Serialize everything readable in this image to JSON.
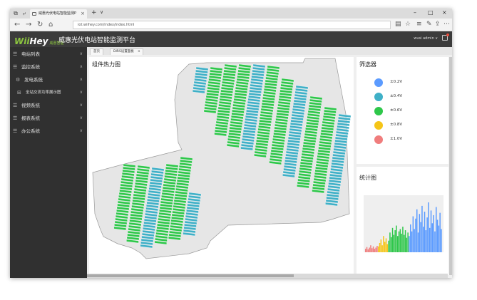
{
  "browser": {
    "tab_title": "威惠光伏电站智能监测P",
    "tab_close": "×",
    "new_tab": "+",
    "tab_list": "∨",
    "minimize": "–",
    "maximize": "□",
    "close": "×",
    "url": "iot.wiihey.com/index/index.html"
  },
  "app": {
    "logo_wii": "Wii",
    "logo_hey": "Hey",
    "logo_cn": "威惠智能",
    "title": "威惠光伏电站智能监测平台",
    "user": "wusi  admin ∨"
  },
  "sidebar": {
    "items": [
      {
        "label": "电站列表",
        "icon": "list-icon",
        "arrow": "∨"
      },
      {
        "label": "监控系统",
        "icon": "list-icon",
        "arrow": "∧"
      },
      {
        "label": "发电系统",
        "icon": "gear-icon",
        "arrow": "∧"
      },
      {
        "label": "全站交流功率展示图",
        "icon": "grid-icon",
        "arrow": "∨"
      },
      {
        "label": "视频系统",
        "icon": "list-icon",
        "arrow": "∨"
      },
      {
        "label": "报表系统",
        "icon": "list-icon",
        "arrow": "∨"
      },
      {
        "label": "办公系统",
        "icon": "list-icon",
        "arrow": "∨"
      }
    ]
  },
  "breadcrumbs": [
    "首页",
    "DIRS设置面板"
  ],
  "breadcrumb_close": "×",
  "heatmap": {
    "title": "组件热力图"
  },
  "filter": {
    "title": "筛选器",
    "items": [
      {
        "label": "±0.2V",
        "color": "#5b9bff"
      },
      {
        "label": "±0.4V",
        "color": "#3fb0c7"
      },
      {
        "label": "±0.6V",
        "color": "#2ec74a"
      },
      {
        "label": "±0.8V",
        "color": "#f5c518"
      },
      {
        "label": "±1.0V",
        "color": "#f07d7d"
      }
    ]
  },
  "stats": {
    "title": "统计图"
  },
  "chart_data": {
    "type": "bar",
    "title": "统计图",
    "xlabel": "",
    "ylabel": "",
    "series": [
      {
        "color": "#f07d7d",
        "values": [
          6,
          9,
          5,
          8,
          12,
          7,
          10,
          6,
          8,
          11
        ]
      },
      {
        "color": "#f5c518",
        "values": [
          10,
          16,
          22,
          12,
          28,
          18,
          24,
          14
        ]
      },
      {
        "color": "#2ec74a",
        "values": [
          20,
          34,
          26,
          42,
          30,
          38,
          46,
          28,
          36,
          40,
          32,
          44,
          30,
          38,
          25,
          34
        ]
      },
      {
        "color": "#5b9bff",
        "values": [
          28,
          48,
          36,
          62,
          40,
          58,
          74,
          34,
          66,
          52,
          80,
          44,
          70,
          38,
          60,
          86,
          42,
          72,
          50,
          64,
          36,
          78,
          56,
          46,
          68,
          40
        ]
      }
    ]
  }
}
